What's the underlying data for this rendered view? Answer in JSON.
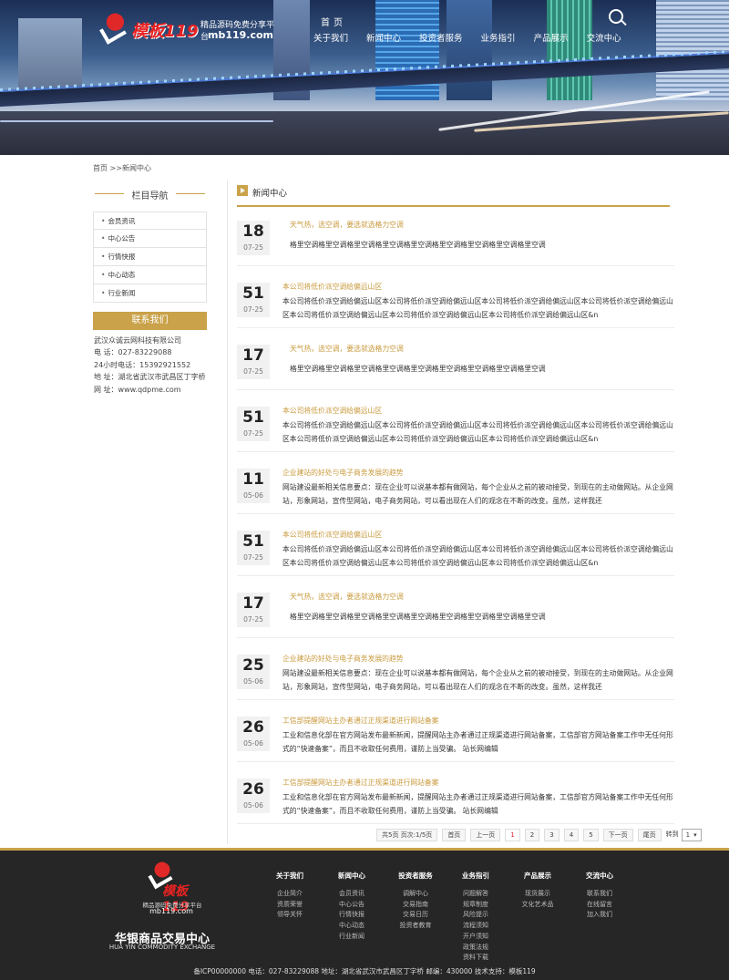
{
  "header": {
    "logo_brand": "模板119",
    "logo_sub": "精品源码免费分享平台",
    "logo_url": "mb119.com",
    "nav_home": "首页",
    "nav": [
      "关于我们",
      "新闻中心",
      "投资者服务",
      "业务指引",
      "产品展示",
      "交流中心"
    ]
  },
  "breadcrumb": "首页 >>新闻中心",
  "sidebar": {
    "title": "栏目导航",
    "items": [
      "会员资讯",
      "中心公告",
      "行情快报",
      "中心动态",
      "行业新闻"
    ],
    "contact_title": "联系我们",
    "contact": {
      "company": "武汉众诚云网科技有限公司",
      "phone": "电  话：027-83229088",
      "hotline": "24小时电话：15392921552",
      "address": "地  址：湖北省武汉市武昌区丁字桥",
      "web": "网  址：www.qdpme.com"
    }
  },
  "main": {
    "heading": "新闻中心",
    "items": [
      {
        "day": "18",
        "md": "07-25",
        "title": "天气热，选空调，要选就选格力空调",
        "desc": "格里空调格里空调格里空调格里空调格里空调格里空调格里空调格里空调格里空调",
        "indent": true
      },
      {
        "day": "51",
        "md": "07-25",
        "title": "本公司将低价派空调给偏远山区",
        "desc": "本公司将低价派空调给偏远山区本公司将低价派空调给偏远山区本公司将低价派空调给偏远山区本公司将低价派空调给偏远山区本公司将低价派空调给偏远山区本公司将低价派空调给偏远山区本公司将低价派空调给偏远山区&n",
        "indent": false
      },
      {
        "day": "17",
        "md": "07-25",
        "title": "天气热，选空调，要选就选格力空调",
        "desc": "格里空调格里空调格里空调格里空调格里空调格里空调格里空调格里空调格里空调",
        "indent": true
      },
      {
        "day": "51",
        "md": "07-25",
        "title": "本公司将低价派空调给偏远山区",
        "desc": "本公司将低价派空调给偏远山区本公司将低价派空调给偏远山区本公司将低价派空调给偏远山区本公司将低价派空调给偏远山区本公司将低价派空调给偏远山区本公司将低价派空调给偏远山区本公司将低价派空调给偏远山区&n",
        "indent": false
      },
      {
        "day": "11",
        "md": "05-06",
        "title": "企业建站的好处与电子商务发展的趋势",
        "desc": "网站建设最新相关信息要点：现在企业可以说基本都有做网站，每个企业从之前的被动接受，到现在的主动做网站。从企业网站，形象网站，宣传型网站，电子商务网站，可以看出现在人们的观念在不断的改变。虽然，这样我还",
        "indent": false
      },
      {
        "day": "51",
        "md": "07-25",
        "title": "本公司将低价派空调给偏远山区",
        "desc": "本公司将低价派空调给偏远山区本公司将低价派空调给偏远山区本公司将低价派空调给偏远山区本公司将低价派空调给偏远山区本公司将低价派空调给偏远山区本公司将低价派空调给偏远山区本公司将低价派空调给偏远山区&n",
        "indent": false
      },
      {
        "day": "17",
        "md": "07-25",
        "title": "天气热，选空调，要选就选格力空调",
        "desc": "格里空调格里空调格里空调格里空调格里空调格里空调格里空调格里空调格里空调",
        "indent": true
      },
      {
        "day": "25",
        "md": "05-06",
        "title": "企业建站的好处与电子商务发展的趋势",
        "desc": "网站建设最新相关信息要点：现在企业可以说基本都有做网站，每个企业从之前的被动接受，到现在的主动做网站。从企业网站，形象网站，宣传型网站，电子商务网站，可以看出现在人们的观念在不断的改变。虽然，这样我还",
        "indent": false
      },
      {
        "day": "26",
        "md": "05-06",
        "title": "工信部提醒网站主办者通过正规渠道进行网站备案",
        "desc": "工业和信息化部在官方网站发布最新新闻，提醒网站主办者通过正规渠道进行网站备案，工信部官方网站备案工作中无任何形式的“快速备案”，而且不收取任何费用，谨防上当受骗。        站长网编辑",
        "indent": false
      },
      {
        "day": "26",
        "md": "05-06",
        "title": "工信部提醒网站主办者通过正规渠道进行网站备案",
        "desc": "工业和信息化部在官方网站发布最新新闻，提醒网站主办者通过正规渠道进行网站备案，工信部官方网站备案工作中无任何形式的“快速备案”，而且不收取任何费用，谨防上当受骗。        站长网编辑",
        "indent": false
      }
    ]
  },
  "pager": {
    "info": "共5页 页次:1/5页",
    "first": "首页",
    "prev": "上一页",
    "pages": [
      "1",
      "2",
      "3",
      "4",
      "5"
    ],
    "current": "1",
    "next": "下一页",
    "last": "尾页",
    "goto": "转到",
    "select": "1"
  },
  "footer": {
    "logo_brand": "模板119",
    "logo_sub": "精品源码免费分享平台",
    "logo_url": "mb119.com",
    "name": "华银商品交易中心",
    "name_en": "HUA YIN COMMODITY EXCHANGE",
    "columns": [
      {
        "h": "关于我们",
        "links": [
          "企业简介",
          "资质荣誉",
          "领导关怀"
        ]
      },
      {
        "h": "新闻中心",
        "links": [
          "会员资讯",
          "中心公告",
          "行情快报",
          "中心动态",
          "行业新闻"
        ]
      },
      {
        "h": "投资者服务",
        "links": [
          "调解中心",
          "交易指南",
          "交易日历",
          "投资者教育"
        ]
      },
      {
        "h": "业务指引",
        "links": [
          "问题解答",
          "规章制度",
          "风险提示",
          "流程须知",
          "开户须知",
          "政策法规",
          "资料下载"
        ]
      },
      {
        "h": "产品展示",
        "links": [
          "现货展示",
          "文化艺术品"
        ]
      },
      {
        "h": "交流中心",
        "links": [
          "联系我们",
          "在线留言",
          "加入我们"
        ]
      }
    ],
    "bottom": "备ICP00000000 电话：027-83229088      地址：湖北省武汉市武昌区丁字桥      邮编：430000      技术支持：模板119"
  }
}
